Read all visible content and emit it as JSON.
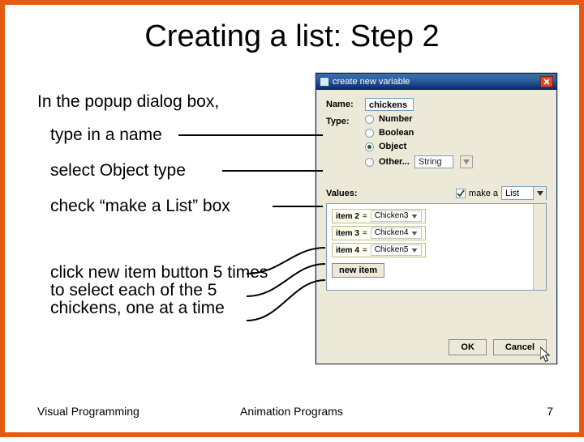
{
  "title": "Creating a list: Step 2",
  "intro": "In the popup dialog box,",
  "bullets": {
    "b1": "type in a name",
    "b2": "select Object type",
    "b3": "check “make a List” box",
    "b4": "click new item button 5 times to select each of the 5 chickens, one at a time"
  },
  "footer": {
    "left": "Visual Programming",
    "center": "Animation Programs",
    "page": "7"
  },
  "dialog": {
    "title": "create new variable",
    "name_label": "Name:",
    "name_value": "chickens",
    "type_label": "Type:",
    "types": {
      "number": "Number",
      "boolean": "Boolean",
      "object": "Object",
      "other": "Other...",
      "other_value": "String"
    },
    "selected_type": "object",
    "values_label": "Values:",
    "make_a_label": "make a",
    "make_a_selected": "List",
    "make_a_checked": true,
    "items": [
      {
        "label": "item 2",
        "value": "Chicken3"
      },
      {
        "label": "item 3",
        "value": "Chicken4"
      },
      {
        "label": "item 4",
        "value": "Chicken5"
      }
    ],
    "new_item": "new item",
    "ok": "OK",
    "cancel": "Cancel"
  }
}
